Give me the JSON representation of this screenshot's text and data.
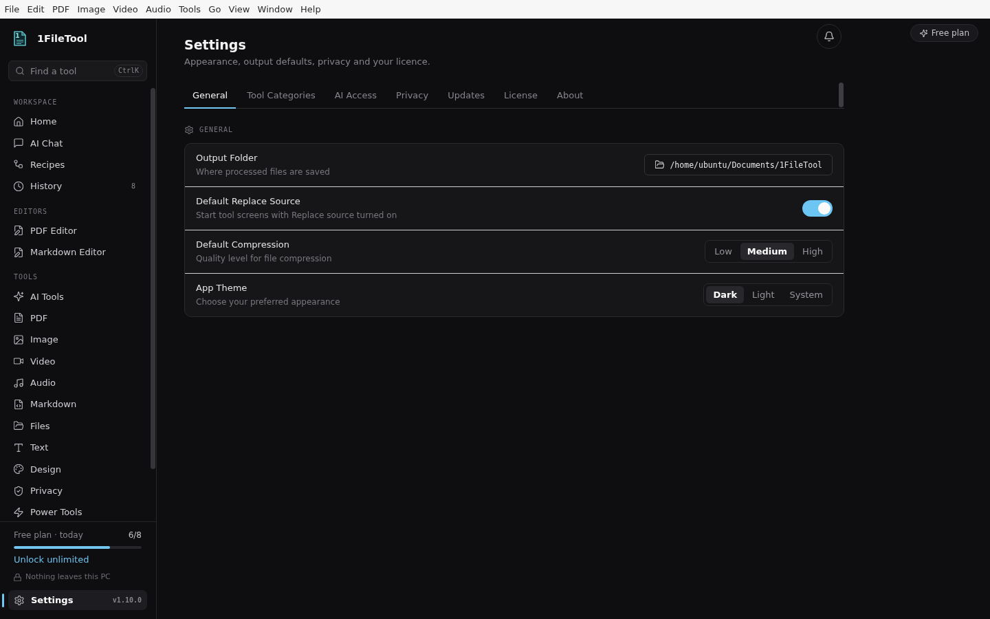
{
  "menu_bar": {
    "items": [
      "File",
      "Edit",
      "PDF",
      "Image",
      "Video",
      "Audio",
      "Tools",
      "Go",
      "View",
      "Window",
      "Help"
    ]
  },
  "sidebar": {
    "brand": {
      "logo_mark": "1",
      "name": "1FileTool"
    },
    "search": {
      "placeholder": "Find a tool",
      "shortcut": "CtrlK"
    },
    "sections": [
      {
        "heading": "WORKSPACE",
        "items": [
          {
            "label": "Home",
            "selected": false
          },
          {
            "label": "AI Chat",
            "selected": false
          },
          {
            "label": "Recipes",
            "selected": false
          },
          {
            "label": "History",
            "count": "8",
            "selected": false
          }
        ]
      },
      {
        "heading": "EDITORS",
        "items": [
          {
            "label": "PDF Editor",
            "selected": false
          },
          {
            "label": "Markdown Editor",
            "selected": false
          }
        ]
      },
      {
        "heading": "TOOLS",
        "items": [
          {
            "label": "AI Tools",
            "selected": false
          },
          {
            "label": "PDF",
            "selected": false
          },
          {
            "label": "Image",
            "selected": false
          },
          {
            "label": "Video",
            "selected": false
          },
          {
            "label": "Audio",
            "selected": false
          },
          {
            "label": "Markdown",
            "selected": false
          },
          {
            "label": "Files",
            "selected": false
          },
          {
            "label": "Text",
            "selected": false
          },
          {
            "label": "Design",
            "selected": false
          },
          {
            "label": "Privacy",
            "selected": false
          },
          {
            "label": "Power Tools",
            "selected": false
          }
        ]
      }
    ],
    "usage": {
      "label": "Free plan · today",
      "count": "6/8",
      "level": 0.75
    },
    "upgrade_link": "Unlock unlimited",
    "privacy_note": "Nothing leaves this PC",
    "settings_item": {
      "label": "Settings",
      "version": "v1.10.0",
      "selected": true
    }
  },
  "header": {
    "plan_badge": "Free plan"
  },
  "page": {
    "title": "Settings",
    "subtitle": "Appearance, output defaults, privacy and your licence."
  },
  "tabs": [
    {
      "label": "General",
      "selected": true
    },
    {
      "label": "Tool Categories",
      "selected": false
    },
    {
      "label": "AI Access",
      "selected": false
    },
    {
      "label": "Privacy",
      "selected": false
    },
    {
      "label": "Updates",
      "selected": false
    },
    {
      "label": "License",
      "selected": false
    },
    {
      "label": "About",
      "selected": false
    }
  ],
  "section": {
    "heading": "GENERAL"
  },
  "settings": [
    {
      "kind": "path",
      "title": "Output Folder",
      "description": "Where processed files are saved",
      "value": "/home/ubuntu/Documents/1FileTool"
    },
    {
      "kind": "toggle",
      "title": "Default Replace Source",
      "description": "Start tool screens with Replace source turned on",
      "on": true
    },
    {
      "kind": "segmented",
      "title": "Default Compression",
      "description": "Quality level for file compression",
      "options": [
        {
          "label": "Low",
          "selected": false
        },
        {
          "label": "Medium",
          "selected": true
        },
        {
          "label": "High",
          "selected": false
        }
      ]
    },
    {
      "kind": "segmented",
      "title": "App Theme",
      "description": "Choose your preferred appearance",
      "options": [
        {
          "label": "Dark",
          "selected": true
        },
        {
          "label": "Light",
          "selected": false
        },
        {
          "label": "System",
          "selected": false
        }
      ]
    }
  ]
}
